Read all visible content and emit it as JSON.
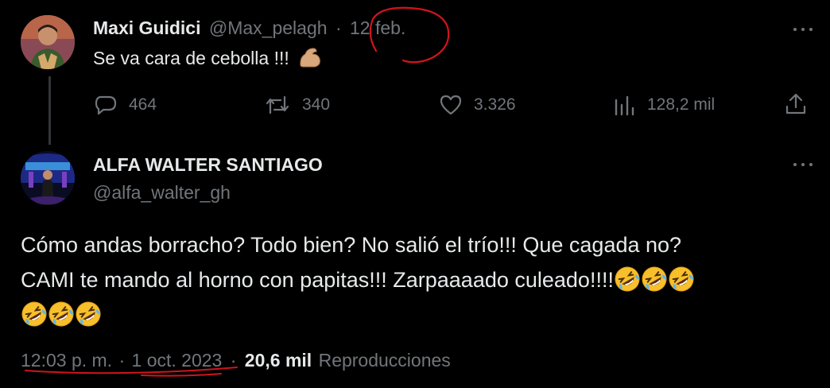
{
  "tweet1": {
    "display_name": "Maxi Guidici",
    "handle": "@Max_pelagh",
    "separator": "·",
    "date": "12 feb.",
    "text": "Se va cara de cebolla !!!",
    "emoji_icon": "flexed-biceps-icon",
    "stats": {
      "replies": "464",
      "retweets": "340",
      "likes": "3.326",
      "views": "128,2 mil"
    }
  },
  "tweet2": {
    "display_name": "ALFA WALTER SANTIAGO",
    "handle": "@alfa_walter_gh",
    "text_line1": "Cómo andas borracho? Todo bien? No salió el trío!!! Que cagada no?",
    "text_line2": "CAMI te mando al horno con papitas!!! Zarpaaaado culeado!!!!",
    "emoji_icon": "rolling-on-floor-laughing-icon",
    "time": "12:03 p. m.",
    "dot": "·",
    "date": "1 oct. 2023",
    "views_count": "20,6 mil",
    "views_label": "Reproducciones"
  },
  "colors": {
    "background": "#000000",
    "text": "#e7e9ea",
    "muted": "#71767b",
    "annotation": "#d0141b"
  }
}
